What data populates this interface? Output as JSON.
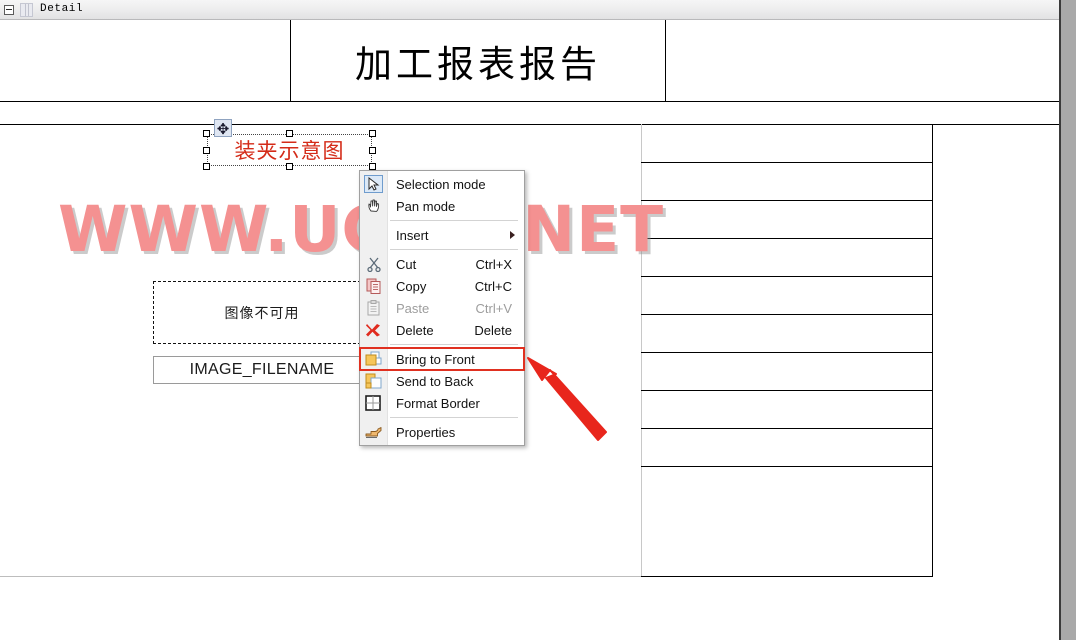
{
  "window": {
    "band_title": "Detail",
    "collapse_icon": "minus-box-icon",
    "band_icon": "band-section-icon"
  },
  "report": {
    "title": "加工报表报告",
    "watermark": "WWW.UGNX.NET",
    "selected_label": "装夹示意图",
    "image_placeholder": "图像不可用",
    "filename_field": "IMAGE_FILENAME",
    "move_cursor_glyph": "✥"
  },
  "colors": {
    "watermark": "#f49191",
    "selected_label_text": "#d42b18",
    "highlight_outline": "#e03020",
    "annotation_arrow": "#e8261c",
    "selection_handle_fill": "#ffffff",
    "menu_background": "#ffffff",
    "menu_gutter": "#f0f0f0",
    "page_background": "#ffffff",
    "app_chrome": "#a9a9a9"
  },
  "context_menu": {
    "items": [
      {
        "id": "selection-mode",
        "label": "Selection mode",
        "shortcut": "",
        "icon": "cursor-arrow-icon",
        "disabled": false,
        "highlighted": false,
        "submenu": false,
        "separator_after": false
      },
      {
        "id": "pan-mode",
        "label": "Pan mode",
        "shortcut": "",
        "icon": "hand-icon",
        "disabled": false,
        "highlighted": false,
        "submenu": false,
        "separator_after": true
      },
      {
        "id": "insert",
        "label": "Insert",
        "shortcut": "",
        "icon": "none-icon",
        "disabled": false,
        "highlighted": false,
        "submenu": true,
        "separator_after": true
      },
      {
        "id": "cut",
        "label": "Cut",
        "shortcut": "Ctrl+X",
        "icon": "scissors-icon",
        "disabled": false,
        "highlighted": false,
        "submenu": false,
        "separator_after": false
      },
      {
        "id": "copy",
        "label": "Copy",
        "shortcut": "Ctrl+C",
        "icon": "copy-icon",
        "disabled": false,
        "highlighted": false,
        "submenu": false,
        "separator_after": false
      },
      {
        "id": "paste",
        "label": "Paste",
        "shortcut": "Ctrl+V",
        "icon": "paste-icon",
        "disabled": true,
        "highlighted": false,
        "submenu": false,
        "separator_after": false
      },
      {
        "id": "delete",
        "label": "Delete",
        "shortcut": "Delete",
        "icon": "red-x-icon",
        "disabled": false,
        "highlighted": false,
        "submenu": false,
        "separator_after": true
      },
      {
        "id": "bring-to-front",
        "label": "Bring to Front",
        "shortcut": "",
        "icon": "bring-to-front-icon",
        "disabled": false,
        "highlighted": true,
        "submenu": false,
        "separator_after": false
      },
      {
        "id": "send-to-back",
        "label": "Send to Back",
        "shortcut": "",
        "icon": "send-to-back-icon",
        "disabled": false,
        "highlighted": false,
        "submenu": false,
        "separator_after": false
      },
      {
        "id": "format-border",
        "label": "Format Border",
        "shortcut": "",
        "icon": "format-border-icon",
        "disabled": false,
        "highlighted": false,
        "submenu": false,
        "separator_after": true
      },
      {
        "id": "properties",
        "label": "Properties",
        "shortcut": "",
        "icon": "properties-hand-icon",
        "disabled": false,
        "highlighted": false,
        "submenu": false,
        "separator_after": false
      }
    ]
  }
}
